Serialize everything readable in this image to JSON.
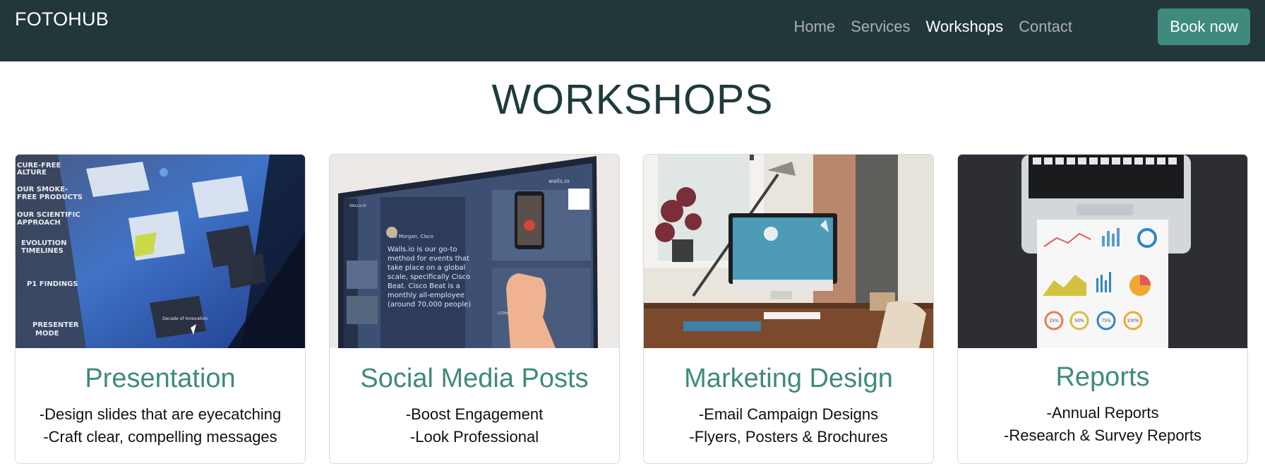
{
  "navbar": {
    "brand": "FOTOHUB",
    "links": [
      {
        "label": "Home",
        "active": false
      },
      {
        "label": "Services",
        "active": false
      },
      {
        "label": "Workshops",
        "active": true
      },
      {
        "label": "Contact",
        "active": false
      }
    ],
    "cta": "Book now"
  },
  "page": {
    "title": "WORKSHOPS"
  },
  "cards": [
    {
      "title": "Presentation",
      "lines": [
        "-Design slides that are eyecatching",
        "-Craft clear, compelling messages"
      ],
      "image": "touchscreen-presentation-photo",
      "image_text": [
        "CURE-FREE",
        "ALTURE",
        "OUR SMOKE-",
        "FREE PRODUCTS",
        "OUR SCIENTIFIC",
        "APPROACH",
        "EVOLUTION",
        "TIMELINES",
        "P1 FINDINGS",
        "PRESENTER",
        "MODE",
        "Decade of Innovation"
      ]
    },
    {
      "title": "Social Media Posts",
      "lines": [
        "-Boost Engagement",
        "-Look Professional"
      ],
      "image": "social-wall-screen-photo",
      "image_text": [
        "WALLS.IO",
        "Liz Morgan, Cisco",
        "Walls.io is our go-to method for events that take place on a global scale, specifically Cisco Beat. Cisco Beat is a monthly all-employee (around 70,000 people) call.",
        "walls.io",
        "LiZMorgan_Cisco"
      ]
    },
    {
      "title": "Marketing Design",
      "lines": [
        "-Email Campaign Designs",
        "-Flyers, Posters & Brochures"
      ],
      "image": "desk-computer-photo",
      "image_text": []
    },
    {
      "title": "Reports",
      "lines": [
        "-Annual Reports",
        "-Research & Survey Reports"
      ],
      "image": "report-charts-photo",
      "image_text": [
        "25%",
        "50%",
        "75%",
        "100%"
      ]
    }
  ]
}
